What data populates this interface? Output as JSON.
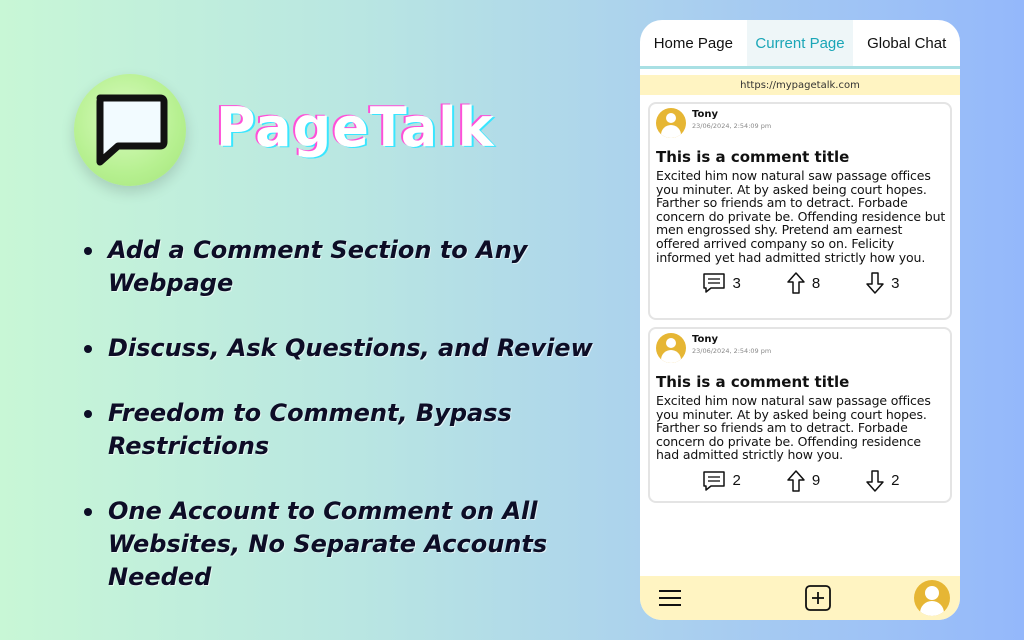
{
  "brand": {
    "name": "PageTalk",
    "logo_icon": "chat-bubble-icon",
    "accent": "#b6f090"
  },
  "features": [
    "Add a Comment Section to Any Webpage",
    "Discuss, Ask Questions, and Review",
    "Freedom to Comment, Bypass Restrictions",
    "One Account to Comment on All Websites, No Separate Accounts Needed"
  ],
  "phone": {
    "tabs": [
      {
        "label": "Home Page",
        "active": false
      },
      {
        "label": "Current Page",
        "active": true
      },
      {
        "label": "Global Chat",
        "active": false
      }
    ],
    "url": "https://mypagetalk.com",
    "comments": [
      {
        "author": "Tony",
        "time": "23/06/2024, 2:54:09 pm",
        "title": "This is a comment title",
        "body": "Excited him now natural saw passage offices you minuter. At by asked being court hopes. Farther so friends am to detract. Forbade concern do private be. Offending residence but men engrossed shy. Pretend am earnest offered arrived company so on. Felicity informed yet had admitted strictly how you.",
        "replies": "3",
        "upvotes": "8",
        "downvotes": "3"
      },
      {
        "author": "Tony",
        "time": "23/06/2024, 2:54:09 pm",
        "title": "This is a comment title",
        "body": "Excited him now natural saw passage offices you minuter. At by asked being court hopes. Farther so friends am to detract. Forbade concern do private be. Offending residence had admitted strictly how you.",
        "replies": "2",
        "upvotes": "9",
        "downvotes": "2"
      }
    ],
    "bottom_bar": {
      "menu_icon": "hamburger-menu-icon",
      "add_icon": "plus-square-icon",
      "profile_icon": "user-avatar-icon"
    },
    "colors": {
      "active_tab": "#1aa6b7",
      "url_bar": "#fff4c2",
      "avatar": "#e6b634"
    }
  }
}
